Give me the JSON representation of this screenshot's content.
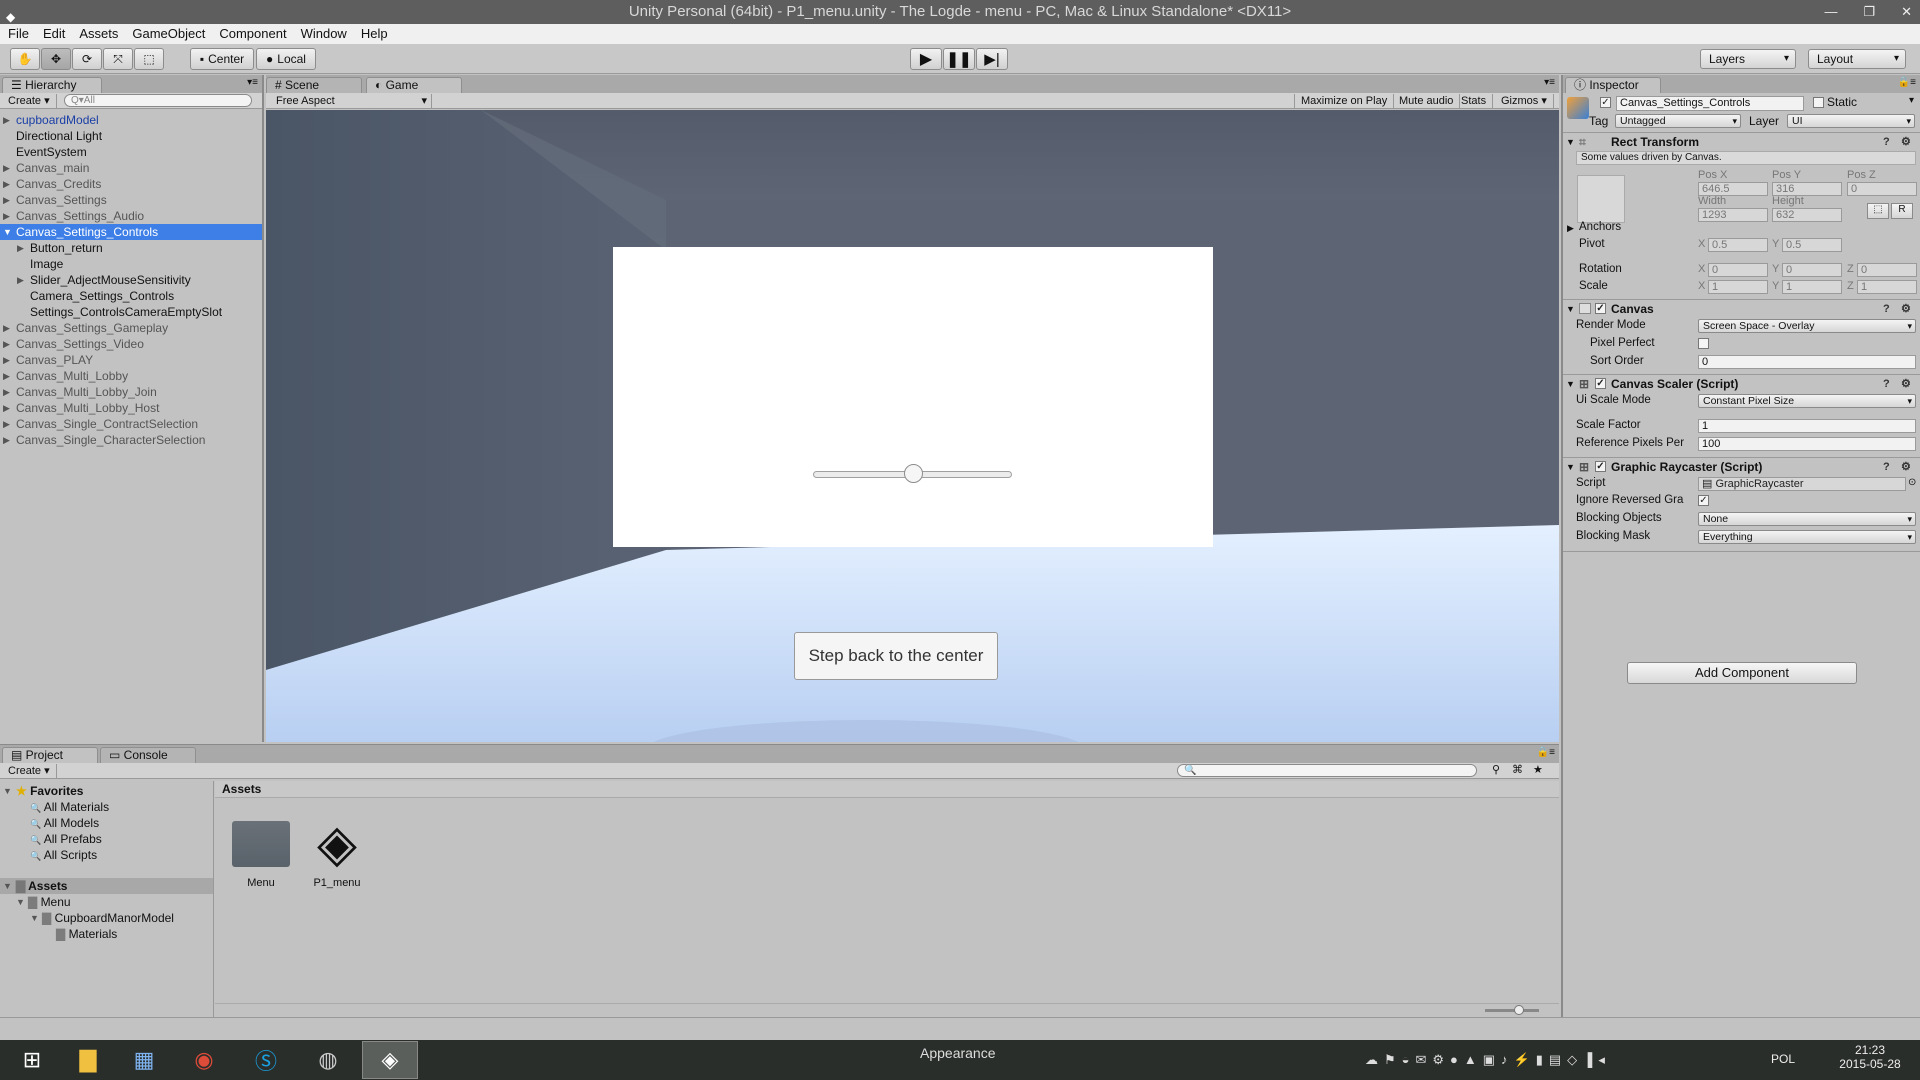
{
  "window": {
    "title": "Unity Personal (64bit) - P1_menu.unity - The Logde - menu - PC, Mac & Linux Standalone* <DX11>"
  },
  "menu": [
    "File",
    "Edit",
    "Assets",
    "GameObject",
    "Component",
    "Window",
    "Help"
  ],
  "toolbar": {
    "pivot": "Center",
    "space": "Local",
    "layers": "Layers",
    "layout": "Layout"
  },
  "hierarchy": {
    "tab": "Hierarchy",
    "create": "Create",
    "search_placeholder": "Q▾All",
    "items": [
      {
        "label": "cupboardModel",
        "style": "blue",
        "indent": 0,
        "arrow": "▶"
      },
      {
        "label": "Directional Light",
        "style": "",
        "indent": 0,
        "arrow": ""
      },
      {
        "label": "EventSystem",
        "style": "",
        "indent": 0,
        "arrow": ""
      },
      {
        "label": "Canvas_main",
        "style": "gray",
        "indent": 0,
        "arrow": "▶"
      },
      {
        "label": "Canvas_Credits",
        "style": "gray",
        "indent": 0,
        "arrow": "▶"
      },
      {
        "label": "Canvas_Settings",
        "style": "gray",
        "indent": 0,
        "arrow": "▶"
      },
      {
        "label": "Canvas_Settings_Audio",
        "style": "gray",
        "indent": 0,
        "arrow": "▶"
      },
      {
        "label": "Canvas_Settings_Controls",
        "style": "sel",
        "indent": 0,
        "arrow": "▼"
      },
      {
        "label": "Button_return",
        "style": "",
        "indent": 1,
        "arrow": "▶"
      },
      {
        "label": "Image",
        "style": "",
        "indent": 1,
        "arrow": ""
      },
      {
        "label": "Slider_AdjectMouseSensitivity",
        "style": "",
        "indent": 1,
        "arrow": "▶"
      },
      {
        "label": "Camera_Settings_Controls",
        "style": "",
        "indent": 1,
        "arrow": ""
      },
      {
        "label": "Settings_ControlsCameraEmptySlot",
        "style": "",
        "indent": 1,
        "arrow": ""
      },
      {
        "label": "Canvas_Settings_Gameplay",
        "style": "gray",
        "indent": 0,
        "arrow": "▶"
      },
      {
        "label": "Canvas_Settings_Video",
        "style": "gray",
        "indent": 0,
        "arrow": "▶"
      },
      {
        "label": "Canvas_PLAY",
        "style": "gray",
        "indent": 0,
        "arrow": "▶"
      },
      {
        "label": "Canvas_Multi_Lobby",
        "style": "gray",
        "indent": 0,
        "arrow": "▶"
      },
      {
        "label": "Canvas_Multi_Lobby_Join",
        "style": "gray",
        "indent": 0,
        "arrow": "▶"
      },
      {
        "label": "Canvas_Multi_Lobby_Host",
        "style": "gray",
        "indent": 0,
        "arrow": "▶"
      },
      {
        "label": "Canvas_Single_ContractSelection",
        "style": "gray",
        "indent": 0,
        "arrow": "▶"
      },
      {
        "label": "Canvas_Single_CharacterSelection",
        "style": "gray",
        "indent": 0,
        "arrow": "▶"
      }
    ]
  },
  "scene_tabs": {
    "scene": "Scene",
    "game": "Game"
  },
  "game_bar": {
    "aspect": "Free Aspect",
    "maximize": "Maximize on Play",
    "mute": "Mute audio",
    "stats": "Stats",
    "gizmos": "Gizmos"
  },
  "game_view": {
    "button_label": "Step back to the center",
    "slider_value": 0.5
  },
  "inspector": {
    "tab": "Inspector",
    "object_name": "Canvas_Settings_Controls",
    "static_label": "Static",
    "tag_label": "Tag",
    "tag": "Untagged",
    "layer_label": "Layer",
    "layer": "UI",
    "rect": {
      "title": "Rect Transform",
      "note": "Some values driven by Canvas.",
      "posx_label": "Pos X",
      "posy_label": "Pos Y",
      "posz_label": "Pos Z",
      "posx": "646.5",
      "posy": "316",
      "posz": "0",
      "width_label": "Width",
      "height_label": "Height",
      "width": "1293",
      "height": "632",
      "anchors": "Anchors",
      "pivot": "Pivot",
      "pivot_x": "0.5",
      "pivot_y": "0.5",
      "rotation": "Rotation",
      "rot_x": "0",
      "rot_y": "0",
      "rot_z": "0",
      "scale": "Scale",
      "scale_x": "1",
      "scale_y": "1",
      "scale_z": "1"
    },
    "canvas": {
      "title": "Canvas",
      "render_mode_label": "Render Mode",
      "render_mode": "Screen Space - Overlay",
      "pixel_perfect": "Pixel Perfect",
      "sort_order_label": "Sort Order",
      "sort_order": "0"
    },
    "scaler": {
      "title": "Canvas Scaler (Script)",
      "mode_label": "Ui Scale Mode",
      "mode": "Constant Pixel Size",
      "factor_label": "Scale Factor",
      "factor": "1",
      "ref_label": "Reference Pixels Per",
      "ref": "100"
    },
    "raycaster": {
      "title": "Graphic Raycaster (Script)",
      "script_label": "Script",
      "script": "GraphicRaycaster",
      "ignore_label": "Ignore Reversed Gra",
      "blocking_label": "Blocking Objects",
      "blocking": "None",
      "mask_label": "Blocking Mask",
      "mask": "Everything"
    },
    "add_component": "Add Component"
  },
  "project": {
    "tab_project": "Project",
    "tab_console": "Console",
    "create": "Create",
    "favorites": "Favorites",
    "fav_items": [
      "All Materials",
      "All Models",
      "All Prefabs",
      "All Scripts"
    ],
    "assets_root": "Assets",
    "tree": [
      {
        "label": "Menu",
        "indent": 1
      },
      {
        "label": "CupboardManorModel",
        "indent": 2
      },
      {
        "label": "Materials",
        "indent": 3
      }
    ],
    "breadcrumb": "Assets",
    "assets": [
      {
        "label": "Menu",
        "type": "folder"
      },
      {
        "label": "P1_menu",
        "type": "unity"
      }
    ]
  },
  "taskbar": {
    "center_text": "Appearance",
    "lang": "POL",
    "time": "21:23",
    "date": "2015-05-28"
  }
}
